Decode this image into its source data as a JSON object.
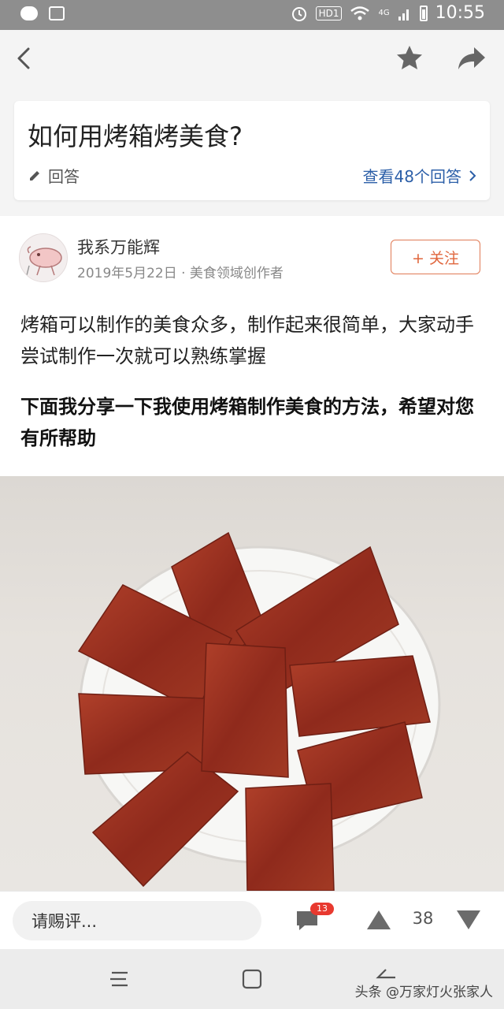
{
  "status_bar": {
    "hd_label": "HD1",
    "network_label": "4G",
    "time": "10:55"
  },
  "question": {
    "title": "如何用烤箱烤美食?",
    "answer_label": "回答",
    "view_answers_label": "查看48个回答"
  },
  "answer": {
    "author_name": "我系万能辉",
    "author_meta": "2019年5月22日 · 美食领域创作者",
    "follow_label": "+ 关注",
    "paragraph1": "烤箱可以制作的美食众多，制作起来很简单，大家动手尝试制作一次就可以熟练掌握",
    "paragraph2": "下面我分享一下我使用烤箱制作美食的方法，希望对您有所帮助"
  },
  "bottom_bar": {
    "comment_placeholder": "请赐评...",
    "comment_count": "13",
    "vote_count": "38"
  },
  "watermark": "头条 @万家灯火张家人",
  "colors": {
    "accent_orange": "#e0663d",
    "link_blue": "#2c5fa8",
    "badge_red": "#e8392f"
  }
}
